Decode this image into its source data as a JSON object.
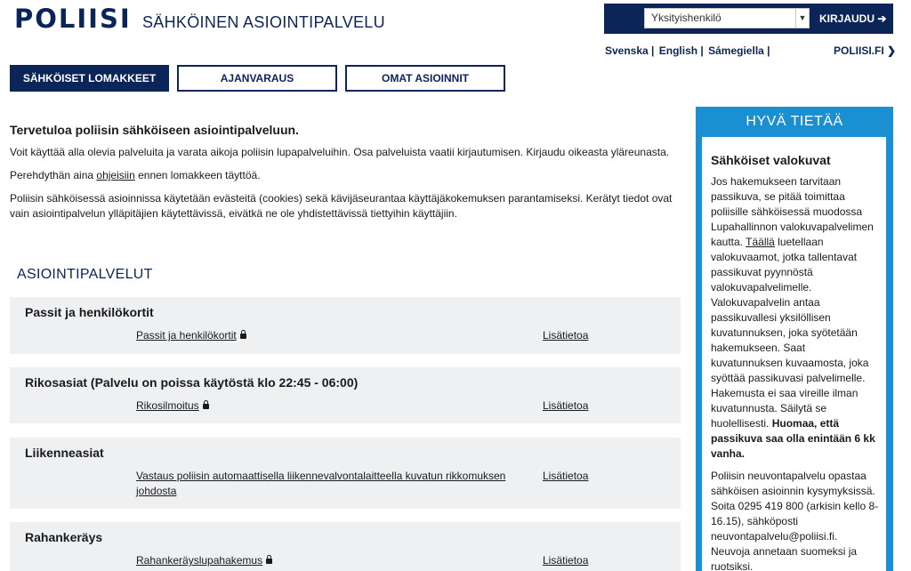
{
  "header": {
    "logo": "POLIISI",
    "subtitle": "SÄHKÖINEN ASIOINTIPALVELU",
    "user_type_selected": "Yksityishenkilö",
    "login_label": "KIRJAUDU ➔",
    "languages": [
      "Svenska |",
      "English |",
      "Sámegiella |"
    ],
    "site_link": "POLIISI.FI ❯"
  },
  "tabs": [
    {
      "label": "SÄHKÖISET LOMAKKEET"
    },
    {
      "label": "AJANVARAUS"
    },
    {
      "label": "OMAT ASIOINNIT"
    }
  ],
  "intro": {
    "heading": "Tervetuloa poliisin sähköiseen asiointipalveluun.",
    "p1": "Voit käyttää alla olevia palveluita ja varata aikoja poliisin lupapalveluihin. Osa palveluista vaatii kirjautumisen. Kirjaudu oikeasta yläreunasta.",
    "p2_before": "Perehdythän aina ",
    "p2_link": "ohjeisiin",
    "p2_after": " ennen lomakkeen täyttöä.",
    "p3": "Poliisin sähköisessä asioinnissa käytetään evästeitä (cookies) sekä kävijäseurantaa käyttäjäkokemuksen parantamiseksi. Kerätyt tiedot ovat vain asiointipalvelun ylläpitäjien käytettävissä, eivätkä ne ole yhdistettävissä tiettyihin käyttäjiin."
  },
  "services_title": "ASIOINTIPALVELUT",
  "services": [
    {
      "title": "Passit ja henkilökortit",
      "link": "Passit ja henkilökortit",
      "more": "Lisätietoa"
    },
    {
      "title": "Rikosasiat (Palvelu on poissa käytöstä klo 22:45 - 06:00)",
      "link": "Rikosilmoitus",
      "more": "Lisätietoa"
    },
    {
      "title": "Liikenneasiat",
      "link": "Vastaus poliisin automaattisella liikennevalvontalaitteella kuvatun rikkomuksen johdosta",
      "more": "Lisätietoa"
    },
    {
      "title": "Rahankeräys",
      "link": "Rahankeräyslupahakemus",
      "more": "Lisätietoa"
    }
  ],
  "sidebar": {
    "heading": "HYVÄ TIETÄÄ",
    "title": "Sähköiset valokuvat",
    "p1_before": "Jos hakemukseen tarvitaan passikuva, se pitää toimittaa poliisille sähköisessä muodossa Lupahallinnon valokuvapalvelimen kautta. ",
    "p1_link": "Täällä",
    "p1_after": " luetellaan valokuvaamot, jotka tallentavat passikuvat pyynnöstä valokuvapalvelimelle. Valokuvapalvelin antaa passikuvallesi yksilöllisen kuvatunnuksen, joka syötetään hakemukseen. Saat kuvatunnuksen kuvaamosta, joka syöttää passikuvasi palvelimelle. Hakemusta ei saa vireille ilman kuvatunnusta. Säilytä se huolellisesti. ",
    "p1_bold": "Huomaa, että passikuva saa olla enintään 6 kk vanha.",
    "p2": "Poliisin neuvontapalvelu opastaa sähköisen asioinnin kysymyksissä. Soita 0295 419 800 (arkisin kello 8-16.15), sähköposti neuvontapalvelu@poliisi.fi. Neuvoja annetaan suomeksi ja ruotsiksi."
  },
  "colors": {
    "brand_navy": "#0b2559",
    "accent_blue": "#1a8fd2",
    "service_bg": "#eef0f2"
  },
  "icons": {
    "lock": "lock-icon",
    "dropdown": "chevron-down-icon",
    "login": "login-arrow-icon"
  }
}
